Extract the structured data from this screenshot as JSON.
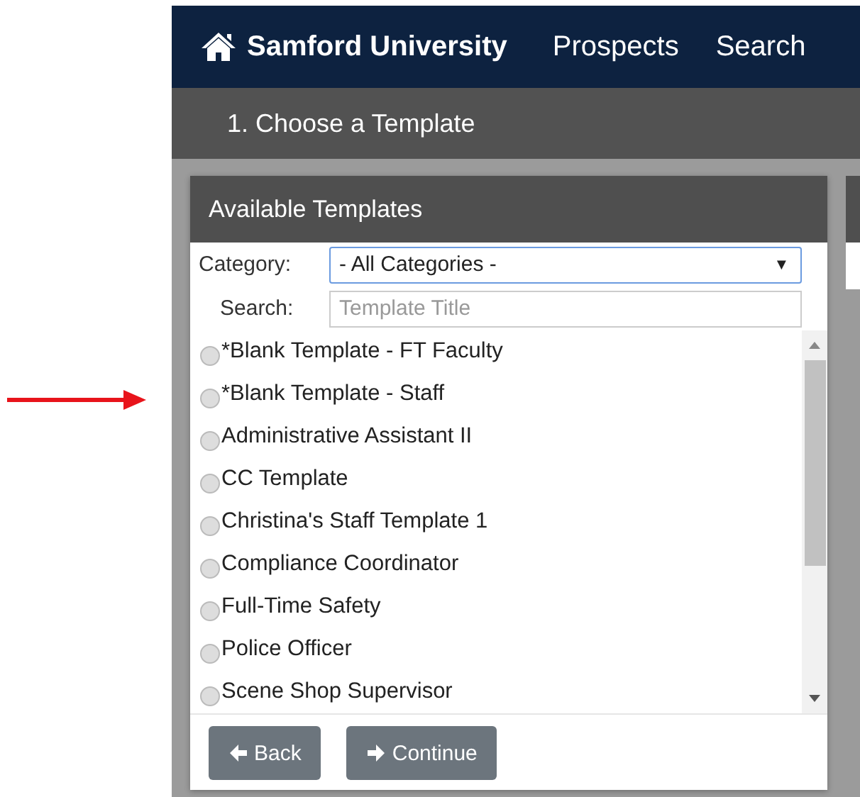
{
  "navbar": {
    "brand": "Samford University",
    "links": [
      "Prospects",
      "Search"
    ]
  },
  "step_bar": {
    "title": "1. Choose a Template"
  },
  "panel": {
    "title": "Available Templates",
    "category": {
      "label": "Category:",
      "value": "- All Categories -",
      "arrow": "▼"
    },
    "search": {
      "label": "Search:",
      "placeholder": "Template Title"
    },
    "templates": [
      {
        "label": "*Blank Template - FT Faculty",
        "selected": false
      },
      {
        "label": "*Blank Template - Staff",
        "selected": false
      },
      {
        "label": "Administrative Assistant II",
        "selected": false
      },
      {
        "label": "CC Template",
        "selected": false
      },
      {
        "label": "Christina's Staff Template 1",
        "selected": false
      },
      {
        "label": "Compliance Coordinator",
        "selected": false
      },
      {
        "label": "Full-Time Safety",
        "selected": false
      },
      {
        "label": "Police Officer",
        "selected": false
      },
      {
        "label": "Scene Shop Supervisor",
        "selected": false
      }
    ],
    "buttons": [
      {
        "label": "Back",
        "kind": "back"
      },
      {
        "label": "Continue",
        "kind": "forward"
      }
    ]
  }
}
